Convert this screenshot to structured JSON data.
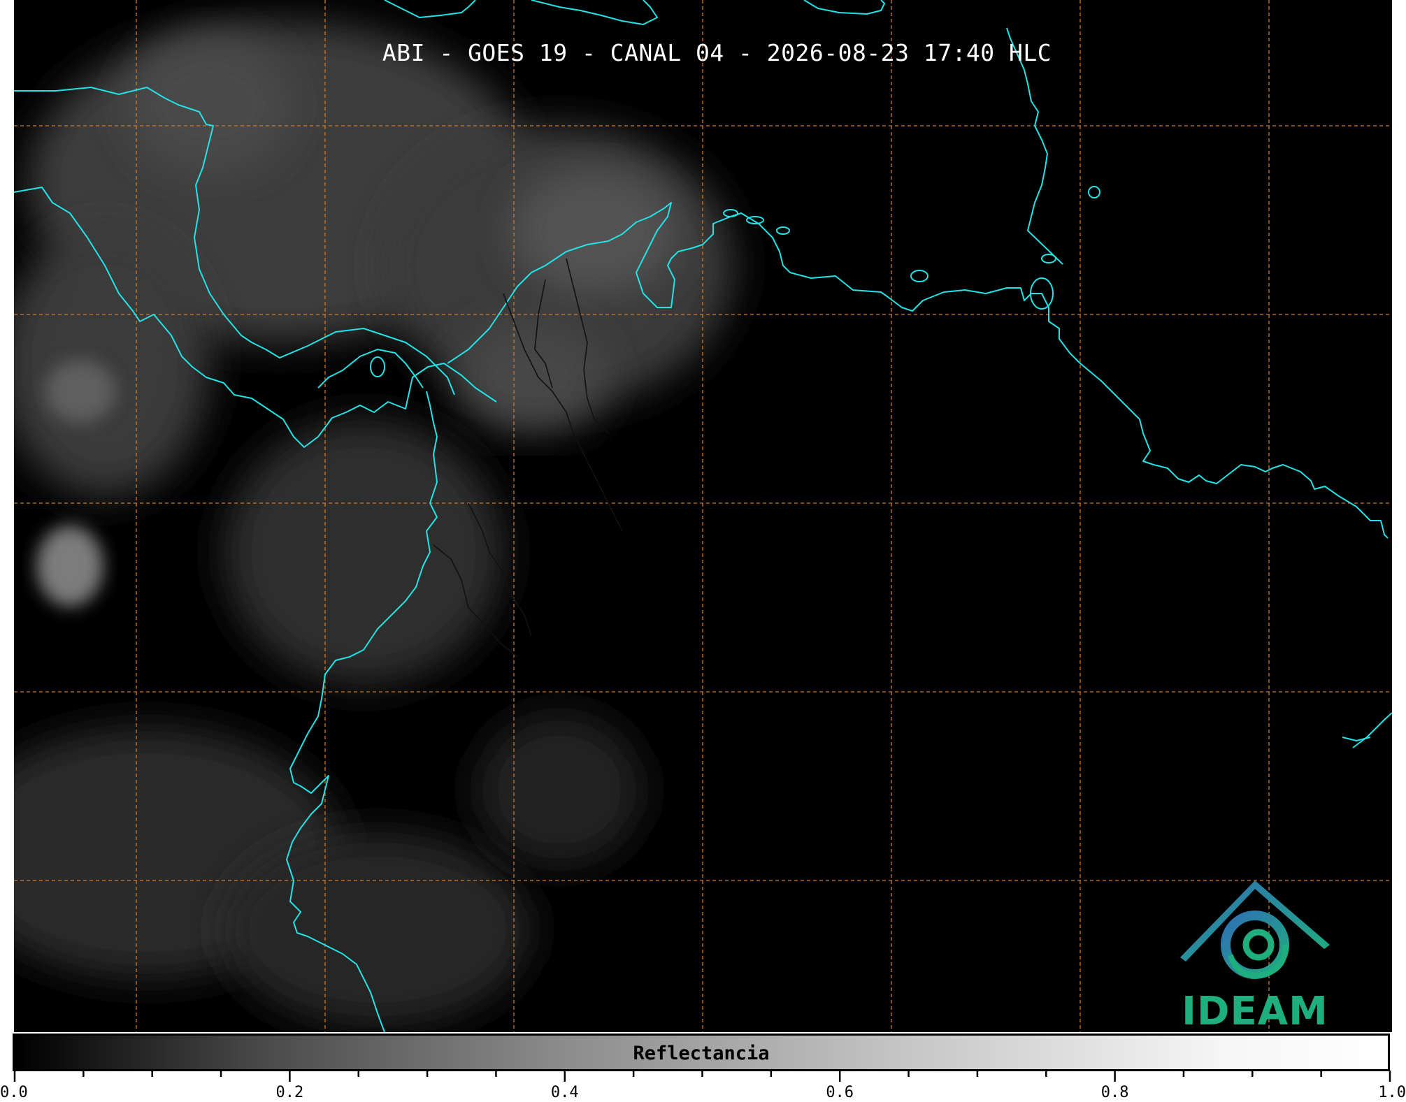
{
  "map": {
    "title": "ABI - GOES 19 - CANAL 04 - 2026-08-23 17:40 HLC",
    "coastline_color": "#22e3e6",
    "gridline_color": "#d47a2a",
    "background_color": "#000000"
  },
  "colorbar": {
    "label": "Reflectancia",
    "min": 0.0,
    "max": 1.0,
    "tick_labels": [
      "0.0",
      "0.2",
      "0.4",
      "0.6",
      "0.8",
      "1.0"
    ]
  },
  "logo": {
    "text": "IDEAM",
    "primary_color": "#1fae7e",
    "secondary_color": "#2f6fb5"
  }
}
